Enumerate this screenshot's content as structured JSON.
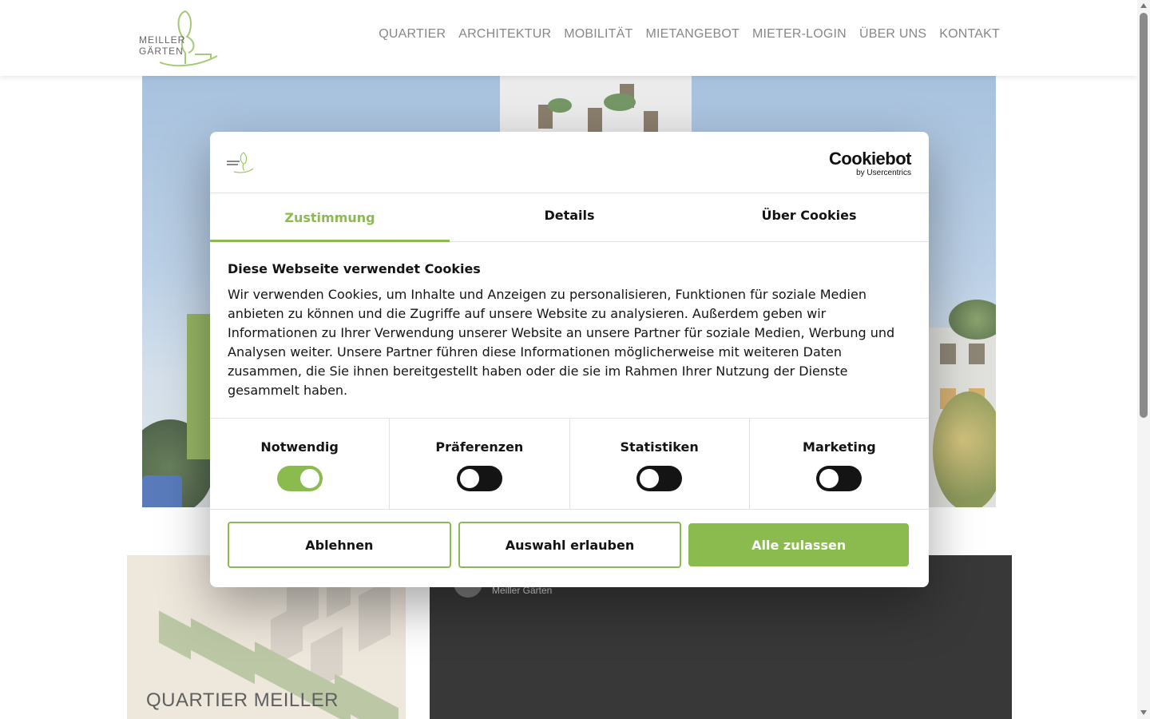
{
  "header": {
    "logo": {
      "line1": "MEILLER",
      "line2": "GÄRTEN"
    },
    "nav": [
      "QUARTIER",
      "ARCHITEKTUR",
      "MOBILITÄT",
      "MIETANGEBOT",
      "MIETER-LOGIN",
      "ÜBER UNS",
      "KONTAKT"
    ]
  },
  "lower": {
    "card_title": "QUARTIER MEILLER",
    "video_channel": "Meiller Gärten"
  },
  "cookie": {
    "brand": "Cookiebot",
    "brand_sub": "by Usercentrics",
    "tabs": [
      "Zustimmung",
      "Details",
      "Über Cookies"
    ],
    "active_tab": "Zustimmung",
    "title": "Diese Webseite verwendet Cookies",
    "text": "Wir verwenden Cookies, um Inhalte und Anzeigen zu personalisieren, Funktionen für soziale Medien anbieten zu können und die Zugriffe auf unsere Website zu analysieren. Außerdem geben wir Informationen zu Ihrer Verwendung unserer Website an unsere Partner für soziale Medien, Werbung und Analysen weiter. Unsere Partner führen diese Informationen möglicherweise mit weiteren Daten zusammen, die Sie ihnen bereitgestellt haben oder die sie im Rahmen Ihrer Nutzung der Dienste gesammelt haben.",
    "toggles": [
      {
        "label": "Notwendig",
        "on": true
      },
      {
        "label": "Präferenzen",
        "on": false
      },
      {
        "label": "Statistiken",
        "on": false
      },
      {
        "label": "Marketing",
        "on": false
      }
    ],
    "buttons": {
      "decline": "Ablehnen",
      "allow_selection": "Auswahl erlauben",
      "allow_all": "Alle zulassen"
    }
  },
  "colors": {
    "accent": "#8bbb4e",
    "text": "#141414"
  }
}
